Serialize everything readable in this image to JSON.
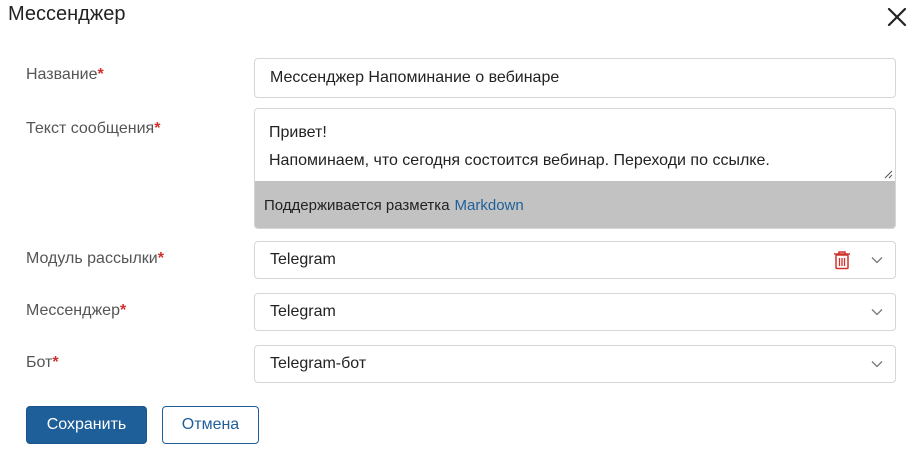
{
  "dialog": {
    "title": "Мессенджер"
  },
  "form": {
    "name": {
      "label": "Название",
      "required": "*",
      "value": "Мессенджер Напоминание о вебинаре"
    },
    "message": {
      "label": "Текст сообщения",
      "required": "*",
      "lines": [
        "Привет!",
        "Напоминаем, что сегодня состоится вебинар. Переходи по ссылке."
      ],
      "markdown_hint": "Поддерживается разметка",
      "markdown_link": "Markdown"
    },
    "module": {
      "label": "Модуль рассылки",
      "required": "*",
      "value": "Telegram"
    },
    "messenger": {
      "label": "Мессенджер",
      "required": "*",
      "value": "Telegram"
    },
    "bot": {
      "label": "Бот",
      "required": "*",
      "value": "Telegram-бот"
    }
  },
  "actions": {
    "save": "Сохранить",
    "cancel": "Отмена"
  },
  "colors": {
    "accent": "#1f5f99",
    "required": "#d0312d",
    "delete": "#d0312d"
  }
}
